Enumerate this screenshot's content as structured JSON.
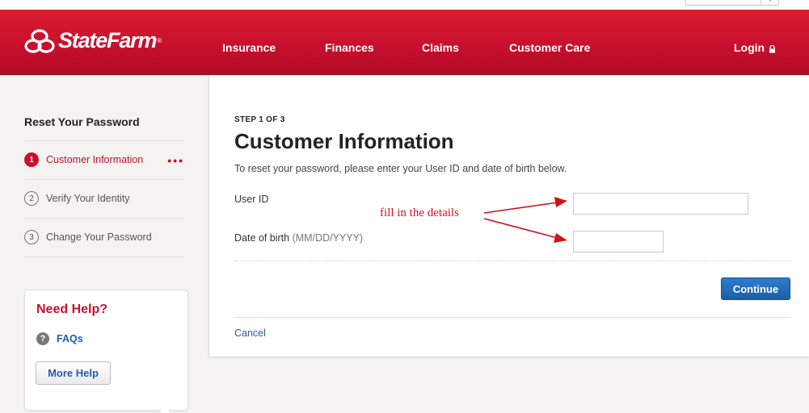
{
  "brand": {
    "name": "StateFarm",
    "registered": "®",
    "color": "#c8102e"
  },
  "nav": {
    "items": [
      {
        "label": "Insurance"
      },
      {
        "label": "Finances"
      },
      {
        "label": "Claims"
      },
      {
        "label": "Customer Care"
      }
    ],
    "login_label": "Login",
    "login_icon": "lock-icon"
  },
  "sidebar": {
    "title": "Reset Your Password",
    "steps": [
      {
        "number": "1",
        "label": "Customer Information",
        "active": true
      },
      {
        "number": "2",
        "label": "Verify Your Identity",
        "active": false
      },
      {
        "number": "3",
        "label": "Change Your Password",
        "active": false
      }
    ],
    "active_indicator": "•••"
  },
  "help": {
    "title": "Need Help?",
    "faq_icon_glyph": "?",
    "faq_label": "FAQs",
    "more_help_label": "More Help"
  },
  "form": {
    "step_indicator": "STEP 1 OF 3",
    "title": "Customer Information",
    "intro": "To reset your password, please enter your User ID and date of birth below.",
    "user_id_label": "User ID",
    "user_id_value": "",
    "dob_label": "Date of birth",
    "dob_hint": "(MM/DD/YYYY)",
    "dob_value": "",
    "continue_label": "Continue",
    "cancel_label": "Cancel"
  },
  "annotation": {
    "text": "fill in the details",
    "color": "#d0141d"
  }
}
